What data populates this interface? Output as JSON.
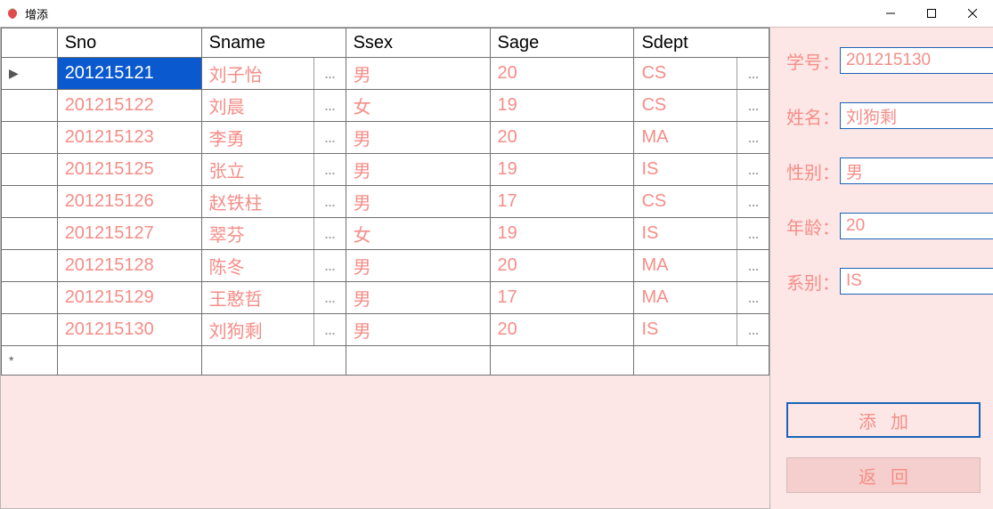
{
  "window": {
    "title": "增添"
  },
  "grid": {
    "columns": [
      "Sno",
      "Sname",
      "Ssex",
      "Sage",
      "Sdept"
    ],
    "selected_row": 0,
    "selected_col": 0,
    "rows": [
      {
        "Sno": "201215121",
        "Sname": "刘子怡",
        "Ssex": "男",
        "Sage": "20",
        "Sdept": "CS"
      },
      {
        "Sno": "201215122",
        "Sname": "刘晨",
        "Ssex": "女",
        "Sage": "19",
        "Sdept": "CS"
      },
      {
        "Sno": "201215123",
        "Sname": "李勇",
        "Ssex": "男",
        "Sage": "20",
        "Sdept": "MA"
      },
      {
        "Sno": "201215125",
        "Sname": "张立",
        "Ssex": "男",
        "Sage": "19",
        "Sdept": "IS"
      },
      {
        "Sno": "201215126",
        "Sname": "赵铁柱",
        "Ssex": "男",
        "Sage": "17",
        "Sdept": "CS"
      },
      {
        "Sno": "201215127",
        "Sname": "翠芬",
        "Ssex": "女",
        "Sage": "19",
        "Sdept": "IS"
      },
      {
        "Sno": "201215128",
        "Sname": "陈冬",
        "Ssex": "男",
        "Sage": "20",
        "Sdept": "MA"
      },
      {
        "Sno": "201215129",
        "Sname": "王憨哲",
        "Ssex": "男",
        "Sage": "17",
        "Sdept": "MA"
      },
      {
        "Sno": "201215130",
        "Sname": "刘狗剩",
        "Ssex": "男",
        "Sage": "20",
        "Sdept": "IS"
      }
    ],
    "ellipsis_columns": [
      "Sname",
      "Sdept"
    ]
  },
  "form": {
    "labels": {
      "sno": "学号：",
      "sname": "姓名：",
      "ssex": "性别：",
      "sage": "年龄：",
      "sdept": "系别："
    },
    "values": {
      "sno": "201215130",
      "sname": "刘狗剩",
      "ssex": "男",
      "sage": "20",
      "sdept": "IS"
    },
    "add_label": "添加",
    "back_label": "返回"
  }
}
